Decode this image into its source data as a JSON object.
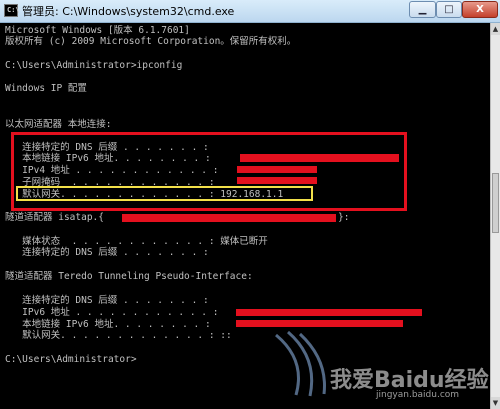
{
  "window": {
    "title": "管理员: C:\\Windows\\system32\\cmd.exe",
    "icon_label": "C:\\",
    "controls": {
      "minimize": "▁",
      "maximize": "□",
      "close": "X"
    }
  },
  "console": {
    "lines": [
      "Microsoft Windows [版本 6.1.7601]",
      "版权所有 (c) 2009 Microsoft Corporation。保留所有权利。",
      "C:\\Users\\Administrator>ipconfig",
      "Windows IP 配置",
      "以太网适配器 本地连接:",
      "   连接特定的 DNS 后缀 . . . . . . . :",
      "   本地链接 IPv6 地址. . . . . . . . :",
      "   IPv4 地址 . . . . . . . . . . . . :",
      "   子网掩码  . . . . . . . . . . . . :",
      "   默认网关. . . . . . . . . . . . . : 192.168.1.1",
      "隧道适配器 isatap.{",
      "}:",
      "   媒体状态  . . . . . . . . . . . . : 媒体已断开",
      "   连接特定的 DNS 后缀 . . . . . . . :",
      "隧道适配器 Teredo Tunneling Pseudo-Interface:",
      "   连接特定的 DNS 后缀 . . . . . . . :",
      "   IPv6 地址 . . . . . . . . . . . . :",
      "   本地链接 IPv6 地址. . . . . . . . :",
      "   默认网关. . . . . . . . . . . . . : ::",
      "C:\\Users\\Administrator>"
    ]
  },
  "watermark": {
    "text": "我爱Baidu经验",
    "url": "jingyan.baidu.com"
  },
  "colors": {
    "redaction": "#e4101e",
    "highlight": "#f2e04a",
    "console_text": "#c0c0c0",
    "console_bg": "#000000"
  }
}
